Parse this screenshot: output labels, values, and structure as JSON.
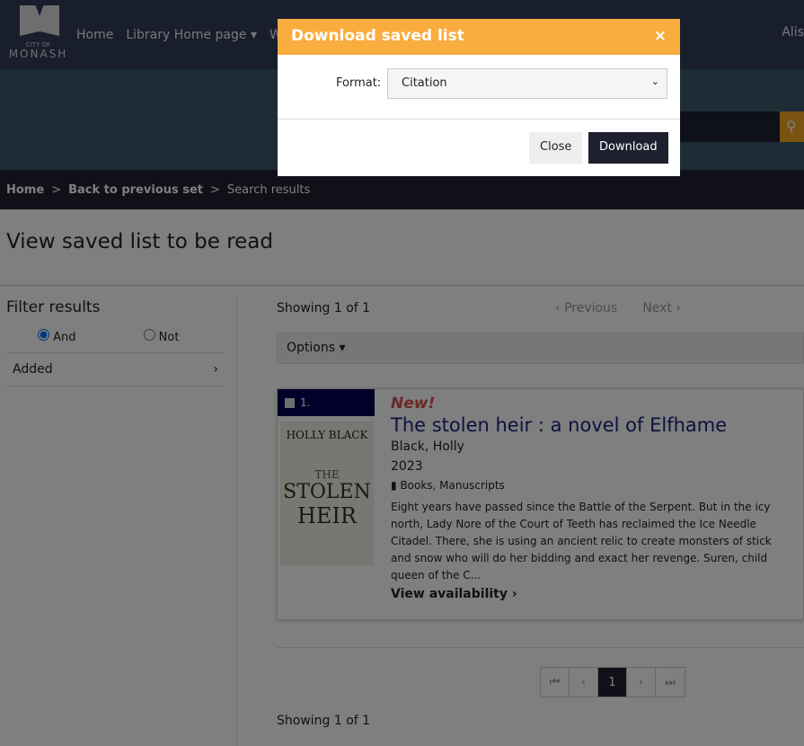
{
  "nav": {
    "logo_top": "CITY OF",
    "logo_bottom": "MONASH",
    "items": [
      "Home",
      "Library Home page ▾",
      "Wh"
    ],
    "user": "Alis"
  },
  "breadcrumb": [
    "Home",
    "Back to previous set",
    "Search results"
  ],
  "page_title": "View saved list to be read",
  "filter": {
    "heading": "Filter results",
    "and": "And",
    "not": "Not",
    "added": "Added"
  },
  "results": {
    "showing": "Showing 1 of 1",
    "previous": "Previous",
    "next": "Next",
    "options": "Options ▾",
    "item": {
      "number": "1.",
      "badge": "New!",
      "title": "The stolen heir : a novel of Elfhame",
      "author": "Black, Holly",
      "year": "2023",
      "format": "Books, Manuscripts",
      "description": "Eight years have passed since the Battle of the Serpent. But in the icy north, Lady Nore of the Court of Teeth has reclaimed the Ice Needle Citadel. There, she is using an ancient relic to create monsters of stick and snow who will do her bidding and exact her revenge. Suren, child queen of the C...",
      "availability": "View availability",
      "cover_author": "HOLLY BLACK",
      "cover_title1": "THE",
      "cover_title2": "STOLEN",
      "cover_title3": "HEIR"
    },
    "page": "1"
  },
  "modal": {
    "title": "Download saved list",
    "close_x": "×",
    "format_label": "Format:",
    "format_value": "Citation",
    "close": "Close",
    "download": "Download"
  },
  "colors": {
    "accent": "#f9ad3f",
    "nav": "#323c5b",
    "title": "#1a237e"
  }
}
